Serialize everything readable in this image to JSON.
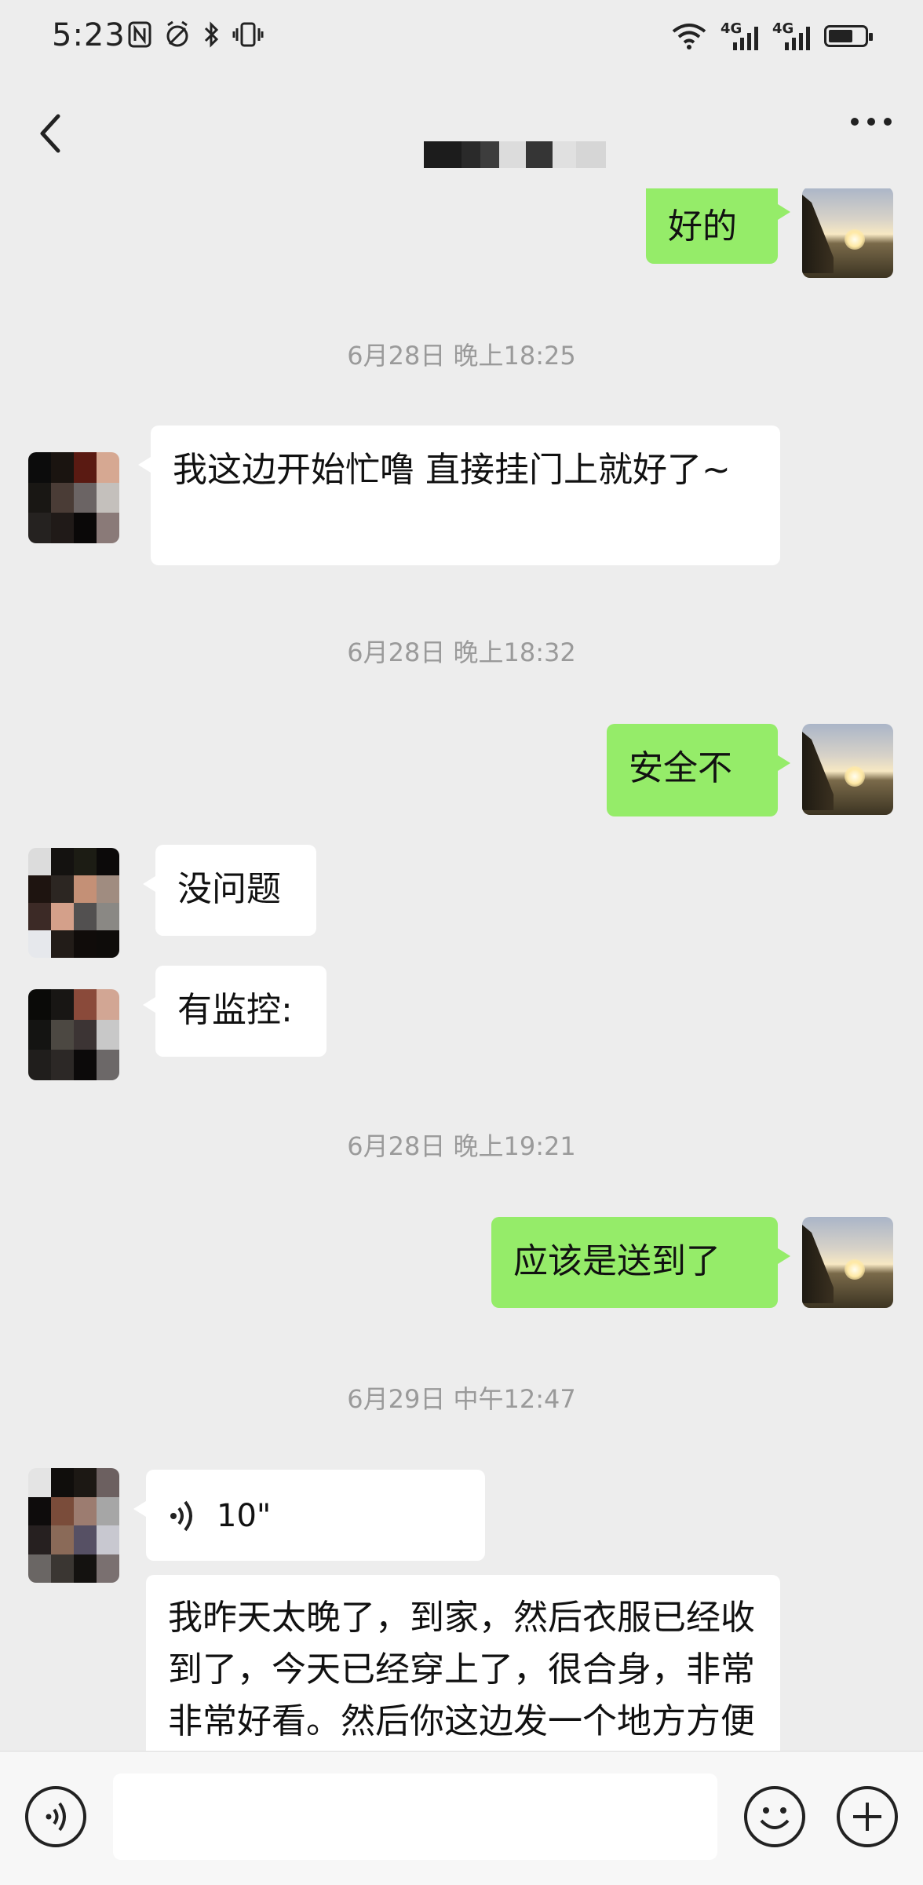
{
  "status_bar": {
    "time": "5:23",
    "left_icons": [
      "nfc-icon",
      "alarm-icon",
      "bluetooth-icon",
      "vibrate-icon"
    ],
    "right_icons": [
      "wifi-icon",
      "signal-4g-icon",
      "signal-4g-icon",
      "battery-icon"
    ],
    "network_label_1": "4G",
    "network_label_2": "4G",
    "battery_level": 0.68
  },
  "nav": {
    "back_icon": "chevron-left-icon",
    "more_icon": "more-dots-icon",
    "title_mosaic_colors": [
      "#1c1c1c",
      "#2a2a2a",
      "#3d3d3d",
      "#dcdcdc",
      "#353535",
      "#e0e0e0",
      "#d6d6d6"
    ]
  },
  "messages": {
    "m1": "好的",
    "t1": "6月28日 晚上18:25",
    "m2": "我这边开始忙噜 直接挂门上就好了~",
    "t2": "6月28日 晚上18:32",
    "m3": "安全不",
    "m4": "没问题",
    "m5": "有监控:",
    "t3": "6月28日 晚上19:21",
    "m6": "应该是送到了",
    "t4": "6月29日 中午12:47",
    "m7_duration": "10\"",
    "m8": "我昨天太晚了，到家，然后衣服已经收到了，今天已经穿上了，很合身，非常非常好看。然后你这边发一个地方方便一张个二维码要发给"
  },
  "avatar_mosaics": {
    "contact_a": [
      "#0c0c0c",
      "#1a1410",
      "#5a1a12",
      "#d6a892",
      "#191714",
      "#4a3c36",
      "#6b6464",
      "#c4c0bc",
      "#252220",
      "#201a18",
      "#0a0808",
      "#8a7a78"
    ],
    "contact_b": [
      "#dcdcdc",
      "#141210",
      "#1c1c14",
      "#0c0a0a",
      "#1e1410",
      "#2c2622",
      "#c49076",
      "#a08c80",
      "#3c2a26",
      "#d4a08a",
      "#525050",
      "#8a8884",
      "#e6e8ec",
      "#221c18",
      "#100c0a",
      "#0e0c0a"
    ],
    "contact_c": [
      "#0a0a08",
      "#181614",
      "#8a4a3a",
      "#d2a694",
      "#141412",
      "#4c4842",
      "#3c3434",
      "#c8c8c8",
      "#201e1c",
      "#2c2826",
      "#0c0a0a",
      "#6c6868"
    ],
    "contact_d": [
      "#e4e4e4",
      "#100e0c",
      "#1c1814",
      "#6c6060",
      "#0e0c0c",
      "#7a4c3a",
      "#9c7c70",
      "#a6a6a6",
      "#262020",
      "#8a6a58",
      "#565064",
      "#c8c8d0",
      "#6a6664",
      "#3a3632",
      "#141210",
      "#7a7070"
    ]
  },
  "input_bar": {
    "voice_icon": "voice-input-icon",
    "emoji_icon": "emoji-icon",
    "plus_icon": "plus-circle-icon",
    "placeholder": ""
  }
}
